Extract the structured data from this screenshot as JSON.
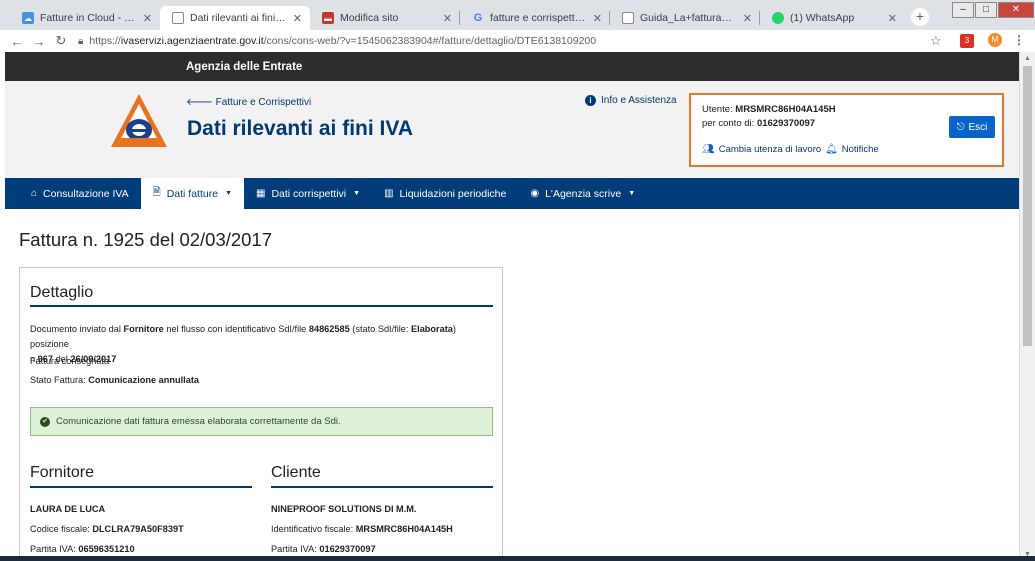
{
  "browser": {
    "tabs": [
      {
        "title": "Fatture in Cloud - Fatturazione",
        "favicon": "cloud-icon",
        "active": false
      },
      {
        "title": "Dati rilevanti ai fini IVA",
        "favicon": "page-icon",
        "active": true
      },
      {
        "title": "Modifica sito",
        "favicon": "site-icon",
        "active": false
      },
      {
        "title": "fatture e corrispettivi vedere fat",
        "favicon": "google-icon",
        "active": false
      },
      {
        "title": "Guida_La+fattura_elettroniva_e",
        "favicon": "page-icon",
        "active": false
      },
      {
        "title": "(1) WhatsApp",
        "favicon": "whatsapp-icon",
        "active": false
      }
    ],
    "url_prefix": "https://",
    "url_domain": "ivaservizi.agenziaentrate.gov.it",
    "url_path": "/cons/cons-web/?v=1545062383904#/fatture/dettaglio/DTE6138109200",
    "ext_badge": "3",
    "avatar_letter": "M"
  },
  "site": {
    "agency": "Agenzia delle Entrate",
    "back_link": "Fatture e Corrispettivi",
    "title": "Dati rilevanti ai fini IVA",
    "info_link": "Info e Assistenza",
    "user": {
      "user_label": "Utente:",
      "user_value": "MRSMRC86H04A145H",
      "account_label": "per conto di:",
      "account_value": "01629370097",
      "logout": "Esci",
      "change_link": "Cambia utenza di lavoro",
      "notifications": "Notifiche"
    },
    "nav": [
      {
        "label": "Consultazione IVA",
        "icon": "home-icon",
        "caret": false,
        "active": false
      },
      {
        "label": "Dati fatture",
        "icon": "document-icon",
        "caret": true,
        "active": true
      },
      {
        "label": "Dati corrispettivi",
        "icon": "calculator-icon",
        "caret": true,
        "active": false
      },
      {
        "label": "Liquidazioni periodiche",
        "icon": "chart-icon",
        "caret": false,
        "active": false
      },
      {
        "label": "L'Agenzia scrive",
        "icon": "message-icon",
        "caret": true,
        "active": false
      }
    ]
  },
  "invoice": {
    "heading": "Fattura n. 1925 del 02/03/2017",
    "detail_title": "Dettaglio",
    "p1_a": "Documento inviato dal ",
    "p1_b": "Fornitore",
    "p1_c": " nel flusso con identificativo SdI/file ",
    "p1_d": "84862585",
    "p1_e": " (stato SdI/file: ",
    "p1_f": "Elaborata",
    "p1_g": ") posizione",
    "p1_h": "n.",
    "p1_i": "967",
    "p1_j": " del ",
    "p1_k": "26/09/2017",
    "delivered": "Fattura consegnata",
    "state_label": "Stato Fattura: ",
    "state_value": "Comunicazione annullata",
    "alert": "Comunicazione dati fattura emessa elaborata correttamente da Sdi.",
    "supplier": {
      "title": "Fornitore",
      "name": "LAURA DE LUCA",
      "cf_label": "Codice fiscale: ",
      "cf_value": "DLCLRA79A50F839T",
      "vat_label": "Partita IVA: ",
      "vat_value": "06596351210"
    },
    "customer": {
      "title": "Cliente",
      "name": "NINEPROOF SOLUTIONS DI M.M.",
      "id_label": "Identificativo fiscale: ",
      "id_value": "MRSMRC86H04A145H",
      "vat_label": "Partita IVA: ",
      "vat_value": "01629370097"
    }
  }
}
